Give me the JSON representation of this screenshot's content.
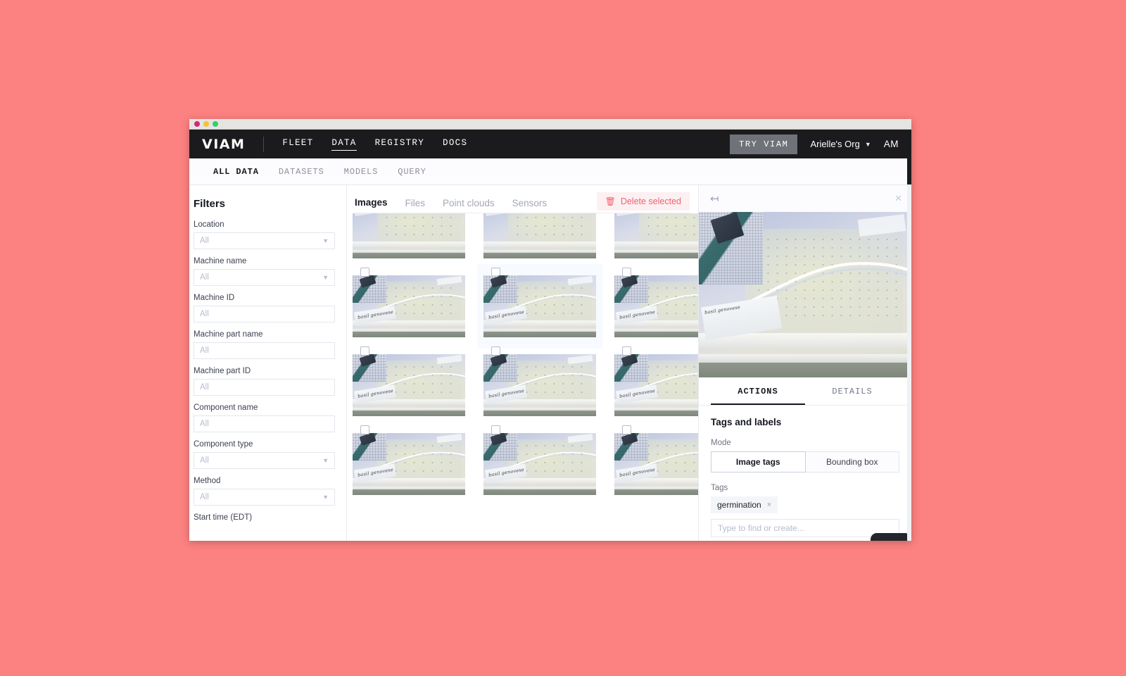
{
  "window": {
    "traffic_lights": [
      "close",
      "minimize",
      "maximize"
    ]
  },
  "topnav": {
    "logo": "VIAM",
    "links": [
      {
        "label": "FLEET",
        "active": false
      },
      {
        "label": "DATA",
        "active": true
      },
      {
        "label": "REGISTRY",
        "active": false
      },
      {
        "label": "DOCS",
        "active": false
      }
    ],
    "try_viam": "TRY VIAM",
    "org_name": "Arielle's Org",
    "org_caret": "chevron-down-icon",
    "avatar_initials": "AM",
    "bg_color": "#1b1b1d"
  },
  "subnav": {
    "tabs": [
      {
        "label": "ALL DATA",
        "active": true
      },
      {
        "label": "DATASETS",
        "active": false
      },
      {
        "label": "MODELS",
        "active": false
      },
      {
        "label": "QUERY",
        "active": false
      }
    ]
  },
  "filters": {
    "title": "Filters",
    "fields": [
      {
        "label": "Location",
        "value": "All",
        "type": "select"
      },
      {
        "label": "Machine name",
        "value": "All",
        "type": "select"
      },
      {
        "label": "Machine ID",
        "value": "All",
        "type": "text"
      },
      {
        "label": "Machine part name",
        "value": "All",
        "type": "text"
      },
      {
        "label": "Machine part ID",
        "value": "All",
        "type": "text"
      },
      {
        "label": "Component name",
        "value": "All",
        "type": "text"
      },
      {
        "label": "Component type",
        "value": "All",
        "type": "select"
      },
      {
        "label": "Method",
        "value": "All",
        "type": "select"
      }
    ],
    "last_label": "Start time (EDT)"
  },
  "data_tabs": {
    "tabs": [
      {
        "label": "Images",
        "active": true
      },
      {
        "label": "Files",
        "active": false
      },
      {
        "label": "Point clouds",
        "active": false
      },
      {
        "label": "Sensors",
        "active": false
      }
    ],
    "delete_button": "Delete selected",
    "delete_icon": "trash-icon",
    "delete_color": "#f4606f"
  },
  "grid": {
    "rows": 4,
    "columns": 3,
    "selected_index": 4,
    "items": [
      {
        "id": 0,
        "variant": "plain",
        "checkbox": false,
        "selected": false
      },
      {
        "id": 1,
        "variant": "plain",
        "checkbox": false,
        "selected": false
      },
      {
        "id": 2,
        "variant": "plain",
        "checkbox": false,
        "selected": false
      },
      {
        "id": 3,
        "variant": "full",
        "checkbox": true,
        "selected": false
      },
      {
        "id": 4,
        "variant": "full",
        "checkbox": true,
        "selected": true
      },
      {
        "id": 5,
        "variant": "full",
        "checkbox": true,
        "selected": false
      },
      {
        "id": 6,
        "variant": "full",
        "checkbox": true,
        "selected": false
      },
      {
        "id": 7,
        "variant": "full",
        "checkbox": true,
        "selected": false
      },
      {
        "id": 8,
        "variant": "full",
        "checkbox": true,
        "selected": false
      },
      {
        "id": 9,
        "variant": "full",
        "checkbox": true,
        "selected": false
      },
      {
        "id": 10,
        "variant": "full",
        "checkbox": true,
        "selected": false
      },
      {
        "id": 11,
        "variant": "full",
        "checkbox": true,
        "selected": false
      }
    ],
    "image_caption": "basil genovese",
    "selection_color": "#3b8ef0"
  },
  "right_panel": {
    "back_icon": "back-arrow-icon",
    "close_icon": "close-icon",
    "preview_caption": "basil genovese",
    "tabs": [
      {
        "label": "ACTIONS",
        "active": true
      },
      {
        "label": "DETAILS",
        "active": false
      }
    ],
    "section_title": "Tags and labels",
    "mode_label": "Mode",
    "mode_options": [
      {
        "label": "Image tags",
        "active": true
      },
      {
        "label": "Bounding box",
        "active": false
      }
    ],
    "tags_label": "Tags",
    "tags": [
      {
        "label": "germination",
        "remove": "×"
      }
    ],
    "tag_input_placeholder": "Type to find or create..."
  },
  "help_widget": {
    "icon": "help-chat-icon",
    "glyph": "?",
    "bg_color": "#23262c"
  }
}
